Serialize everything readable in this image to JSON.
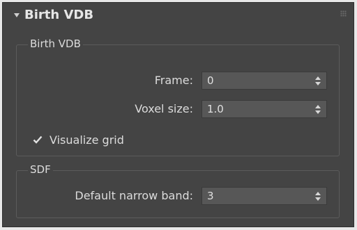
{
  "rollout": {
    "title": "Birth VDB",
    "collapse_icon": "triangle-down-icon",
    "drag_icon": "drag-handle-icon"
  },
  "birth_group": {
    "title": "Birth VDB",
    "frame": {
      "label": "Frame:",
      "value": "0"
    },
    "voxel_size": {
      "label": "Voxel size:",
      "value": "1.0"
    },
    "visualize_grid": {
      "label": "Visualize grid",
      "checked": true,
      "icon": "checkmark-icon"
    }
  },
  "sdf_group": {
    "title": "SDF",
    "narrow_band": {
      "label": "Default narrow band:",
      "value": "3"
    }
  },
  "colors": {
    "panel_bg": "#444444",
    "field_bg": "#575757",
    "text": "#dcdcdc"
  }
}
